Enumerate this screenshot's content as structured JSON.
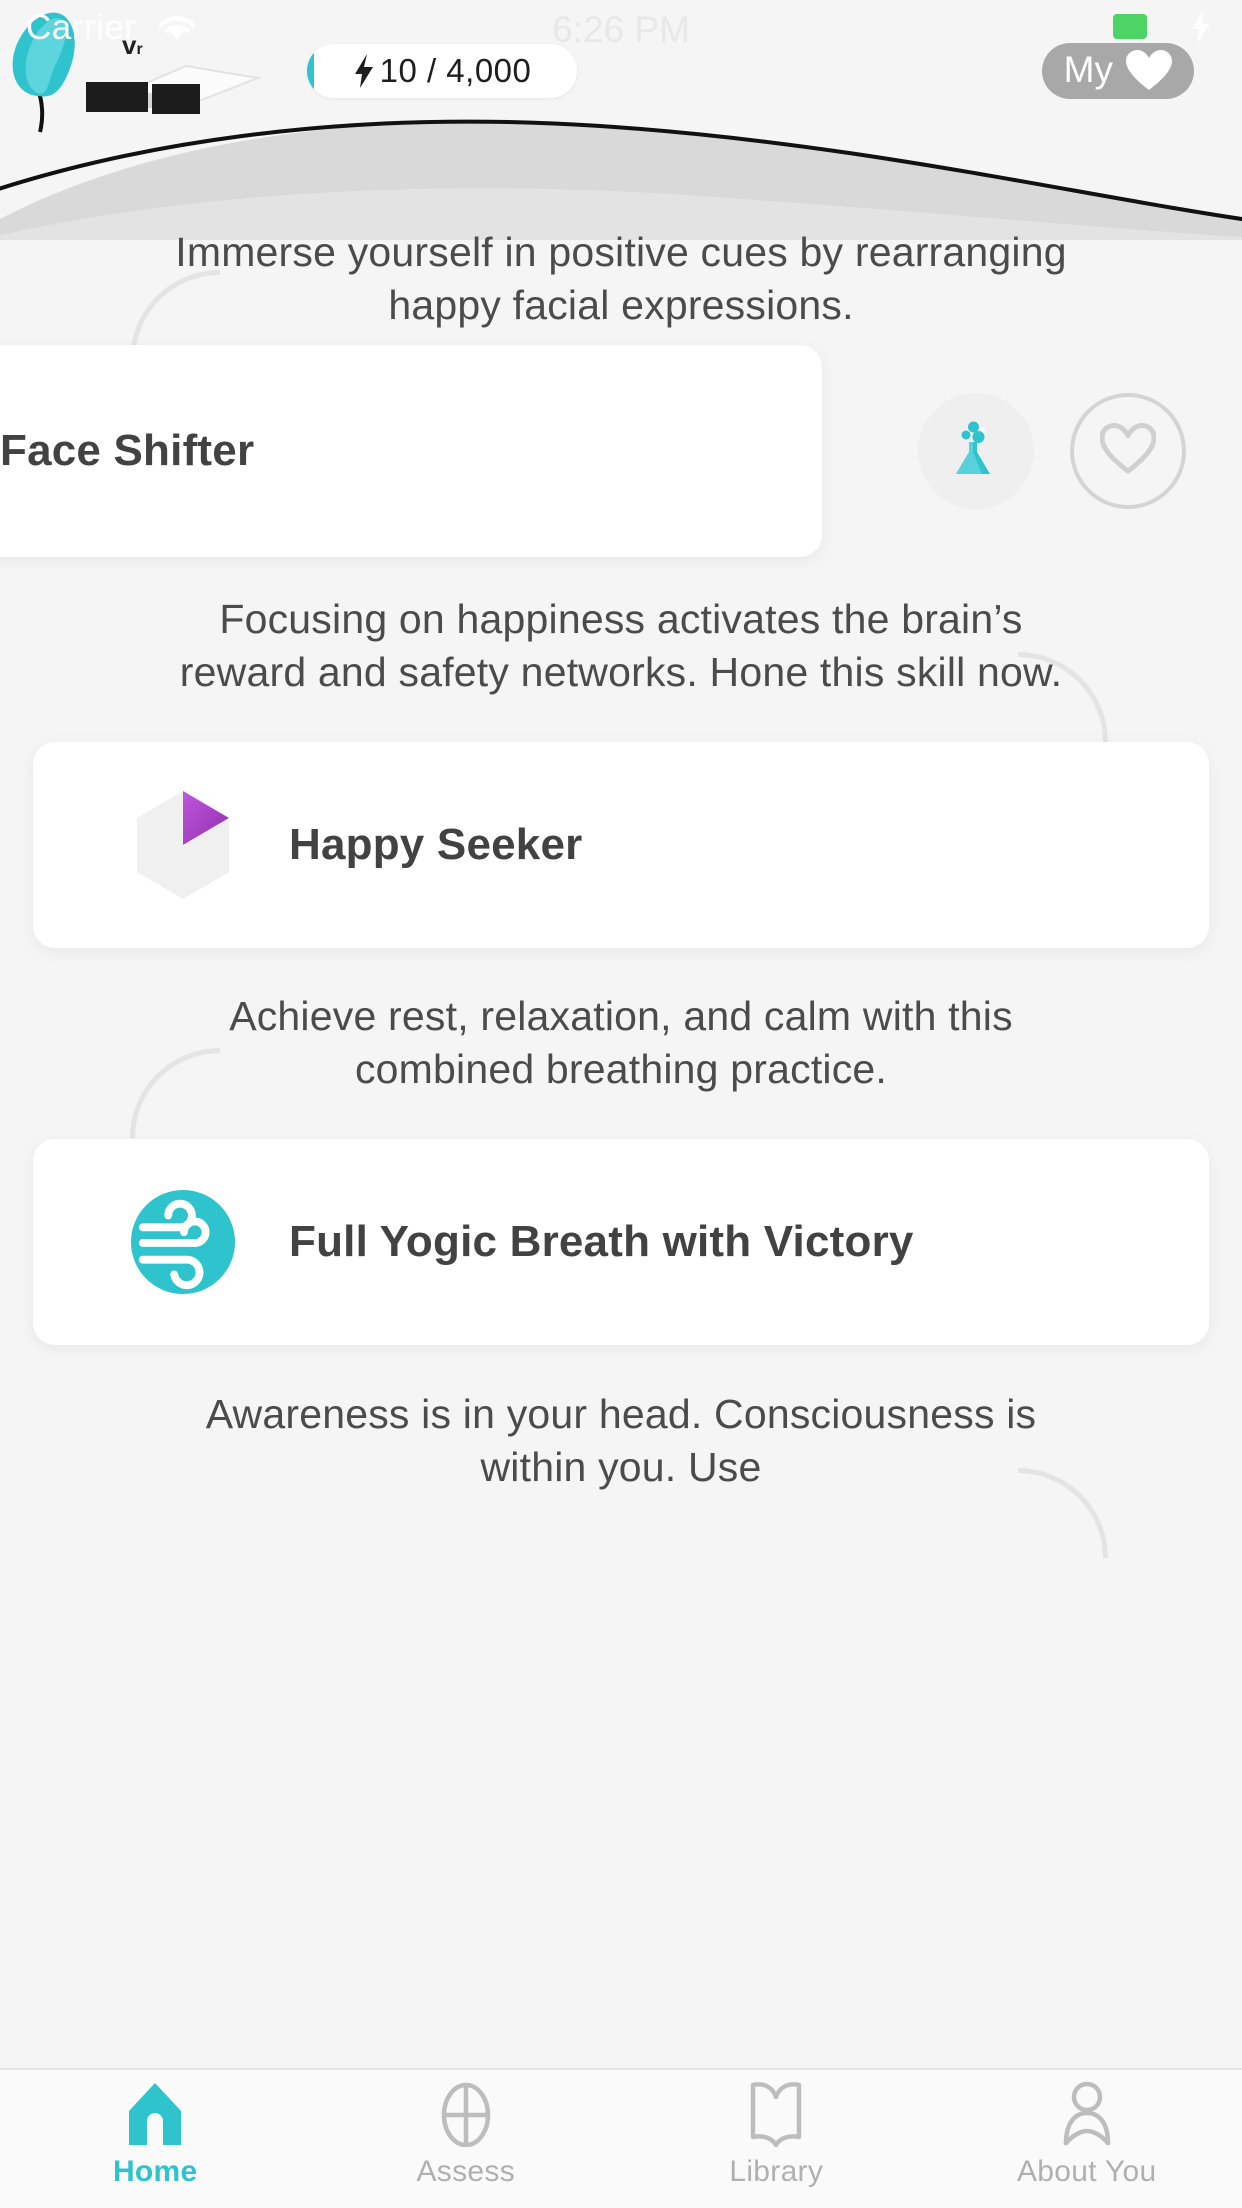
{
  "status_bar": {
    "carrier": "Carrier",
    "time": "6:26 PM",
    "wifi_icon": "wifi-icon",
    "battery_icon": "battery-icon",
    "charging_icon": "lightning-bolt-icon",
    "battery_color": "#4CD465"
  },
  "header": {
    "points": {
      "bolt_icon": "lightning-bolt-icon",
      "value": "10 / 4,000",
      "current": 10,
      "goal": 4000,
      "fill_color": "#2ec3cd"
    },
    "my_button": {
      "label": "My",
      "heart_icon": "heart-filled-icon",
      "background": "#a8a8a8"
    },
    "illustration": {
      "name": "landscape-hill-house-tree",
      "tree_color": "#2ec3cd",
      "hill_color": "#d8d8d8",
      "house_color": "#1c1c1c"
    }
  },
  "feed": [
    {
      "blurb": "Immerse yourself in positive cues by rearranging happy facial expressions.",
      "card": {
        "title": "Face Shifter",
        "swiped": true,
        "icon": "none",
        "actions": [
          {
            "name": "flask-icon",
            "label": "Research",
            "color": "#2ec3cd"
          },
          {
            "name": "heart-outline-icon",
            "label": "Favorite",
            "color": "#d4d4d4"
          }
        ]
      }
    },
    {
      "blurb": "Focusing on happiness activates the brain’s reward and safety networks. Hone this skill now.",
      "card": {
        "title": "Happy Seeker",
        "swiped": false,
        "icon": "hexagon-segments-icon",
        "icon_accent": "#a43fc4",
        "icon_base": "#f0f0f0"
      }
    },
    {
      "blurb": "Achieve rest, relaxation, and calm with this combined breathing practice.",
      "card": {
        "title": "Full Yogic Breath with Victory",
        "swiped": false,
        "icon": "wind-breath-circle-icon",
        "icon_accent": "#ffffff",
        "icon_base": "#2ec3cd"
      }
    },
    {
      "blurb": "Awareness is in your head. Consciousness is within you. Use",
      "card": null
    }
  ],
  "tab_bar": {
    "active_color": "#2ec3cd",
    "inactive_color": "#b0b0b0",
    "items": [
      {
        "label": "Home",
        "icon": "home-icon",
        "active": true
      },
      {
        "label": "Assess",
        "icon": "target-icon",
        "active": false
      },
      {
        "label": "Library",
        "icon": "book-icon",
        "active": false
      },
      {
        "label": "About You",
        "icon": "person-icon",
        "active": false
      }
    ]
  }
}
